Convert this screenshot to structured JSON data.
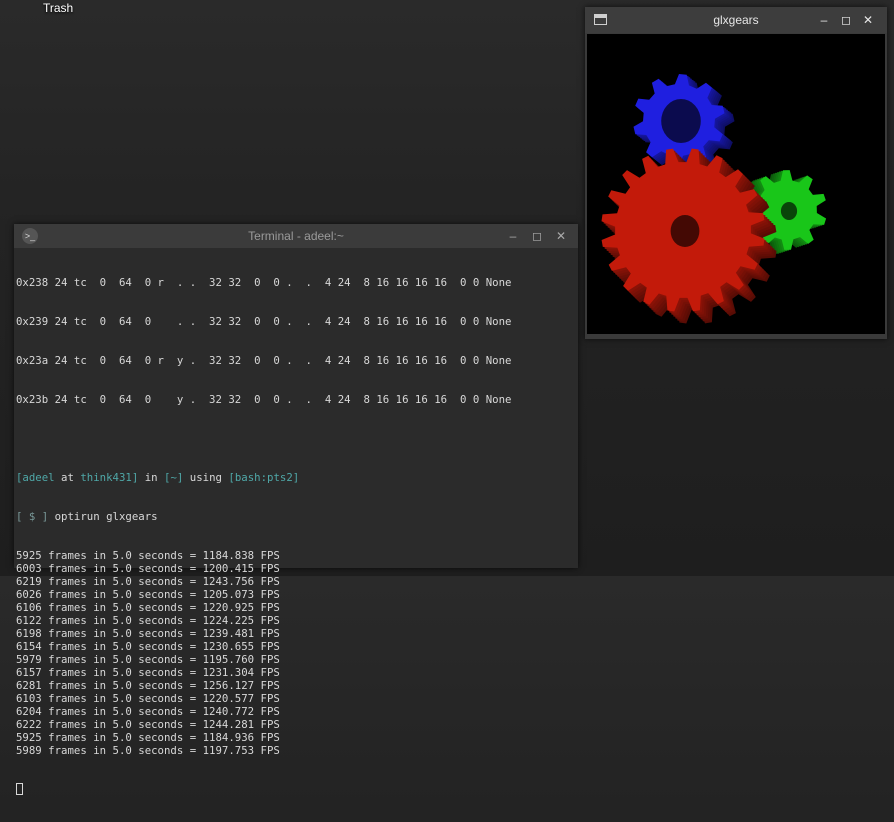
{
  "desktop": {
    "trash_label": "Trash"
  },
  "glxgears": {
    "title": "glxgears",
    "gear_colors": {
      "red": "#c31a0a",
      "green": "#19c619",
      "blue": "#1f1fe0"
    }
  },
  "terminal": {
    "title": "Terminal - adeel:~",
    "xdpy_rows": [
      "0x238 24 tc  0  64  0 r  . .  32 32  0  0 .  .  4 24  8 16 16 16 16  0 0 None",
      "0x239 24 tc  0  64  0    . .  32 32  0  0 .  .  4 24  8 16 16 16 16  0 0 None",
      "0x23a 24 tc  0  64  0 r  y .  32 32  0  0 .  .  4 24  8 16 16 16 16  0 0 None",
      "0x23b 24 tc  0  64  0    y .  32 32  0  0 .  .  4 24  8 16 16 16 16  0 0 None"
    ],
    "prompt": {
      "user": "[adeel",
      "at": "at",
      "host": "think431]",
      "in": "in",
      "dir": "[~]",
      "using": "using",
      "shell": "[bash:pts2]",
      "symbol": "[ $ ]",
      "command": "optirun glxgears"
    },
    "fps_lines": [
      "5925 frames in 5.0 seconds = 1184.838 FPS",
      "6003 frames in 5.0 seconds = 1200.415 FPS",
      "6219 frames in 5.0 seconds = 1243.756 FPS",
      "6026 frames in 5.0 seconds = 1205.073 FPS",
      "6106 frames in 5.0 seconds = 1220.925 FPS",
      "6122 frames in 5.0 seconds = 1224.225 FPS",
      "6198 frames in 5.0 seconds = 1239.481 FPS",
      "6154 frames in 5.0 seconds = 1230.655 FPS",
      "5979 frames in 5.0 seconds = 1195.760 FPS",
      "6157 frames in 5.0 seconds = 1231.304 FPS",
      "6281 frames in 5.0 seconds = 1256.127 FPS",
      "6103 frames in 5.0 seconds = 1220.577 FPS",
      "6204 frames in 5.0 seconds = 1240.772 FPS",
      "6222 frames in 5.0 seconds = 1244.281 FPS",
      "5925 frames in 5.0 seconds = 1184.936 FPS",
      "5989 frames in 5.0 seconds = 1197.753 FPS"
    ]
  }
}
